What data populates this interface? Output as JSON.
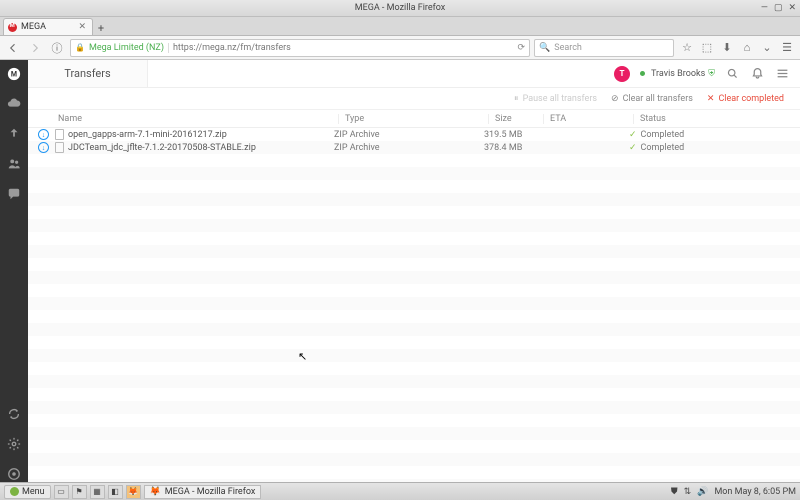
{
  "window": {
    "title": "MEGA - Mozilla Firefox"
  },
  "tab": {
    "label": "MEGA"
  },
  "url": {
    "identity": "Mega Limited (NZ)",
    "path": "https://mega.nz/fm/transfers"
  },
  "search": {
    "placeholder": "Search"
  },
  "header": {
    "page_title": "Transfers",
    "avatar_initial": "T",
    "user_name": "Travis Brooks"
  },
  "actions": {
    "pause": "Pause all transfers",
    "clear_all": "Clear all transfers",
    "clear_completed": "Clear completed"
  },
  "columns": {
    "name": "Name",
    "type": "Type",
    "size": "Size",
    "eta": "ETA",
    "status": "Status"
  },
  "rows": [
    {
      "name": "open_gapps-arm-7.1-mini-20161217.zip",
      "type": "ZIP Archive",
      "size": "319.5 MB",
      "status": "Completed"
    },
    {
      "name": "JDCTeam_jdc_jflte-7.1.2-20170508-STABLE.zip",
      "type": "ZIP Archive",
      "size": "378.4 MB",
      "status": "Completed"
    }
  ],
  "taskbar": {
    "menu": "Menu",
    "active_window": "MEGA - Mozilla Firefox",
    "clock": "Mon May  8,  6:05 PM"
  }
}
